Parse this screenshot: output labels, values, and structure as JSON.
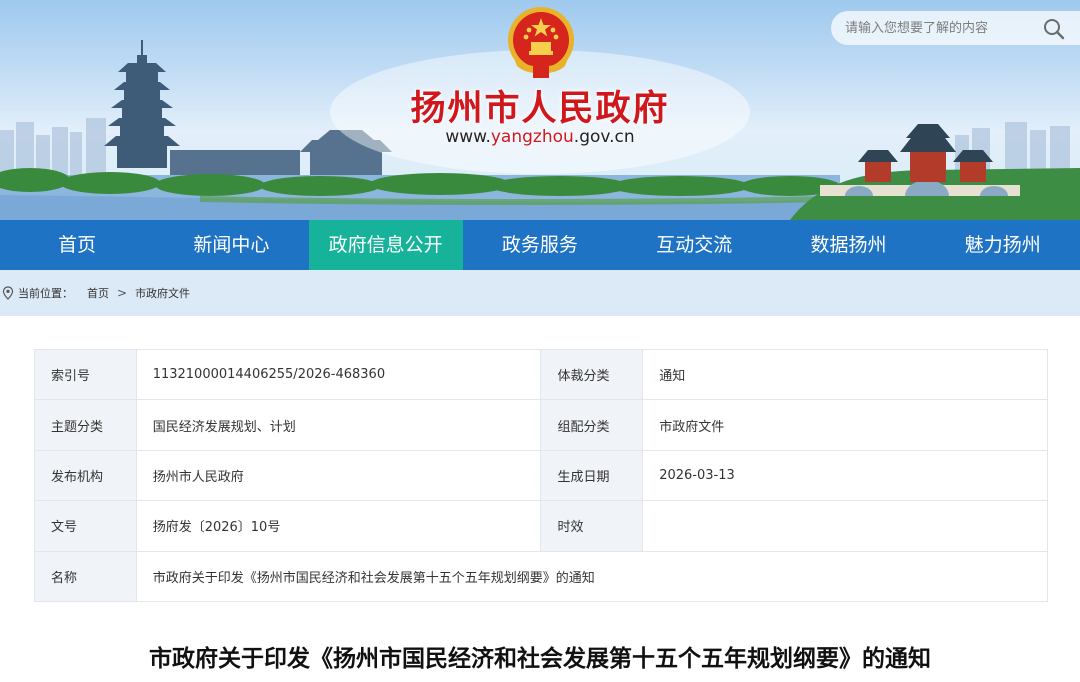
{
  "header": {
    "site_title": "扬州市人民政府",
    "url": {
      "prefix": "www.",
      "domain": "yangzhou",
      "suffix": ".gov.cn"
    },
    "search": {
      "placeholder": "请输入您想要了解的内容"
    }
  },
  "nav": {
    "items": [
      {
        "label": "首页"
      },
      {
        "label": "新闻中心"
      },
      {
        "label": "政府信息公开",
        "active": true
      },
      {
        "label": "政务服务"
      },
      {
        "label": "互动交流"
      },
      {
        "label": "数据扬州"
      },
      {
        "label": "魅力扬州"
      }
    ]
  },
  "breadcrumb": {
    "label": "当前位置：",
    "items": [
      "首页",
      "市政府文件"
    ]
  },
  "meta": {
    "rows": [
      {
        "l1": "索引号",
        "v1": "11321000014406255/2026-468360",
        "l2": "体裁分类",
        "v2": "通知"
      },
      {
        "l1": "主题分类",
        "v1": "国民经济发展规划、计划",
        "l2": "组配分类",
        "v2": "市政府文件"
      },
      {
        "l1": "发布机构",
        "v1": "扬州市人民政府",
        "l2": "生成日期",
        "v2": "2026-03-13"
      },
      {
        "l1": "文号",
        "v1": "扬府发〔2026〕10号",
        "l2": "时效",
        "v2": ""
      }
    ],
    "name_label": "名称",
    "name_value": "市政府关于印发《扬州市国民经济和社会发展第十五个五年规划纲要》的通知"
  },
  "document": {
    "title": "市政府关于印发《扬州市国民经济和社会发展第十五个五年规划纲要》的通知"
  },
  "colors": {
    "nav_bg": "#1e73c4",
    "nav_active": "#16b39a",
    "title_red": "#d0171c",
    "breadcrumb_bg": "#dce9f7"
  },
  "icons": {
    "emblem": "national-emblem-icon",
    "search": "search-icon",
    "location": "location-pin-icon"
  }
}
